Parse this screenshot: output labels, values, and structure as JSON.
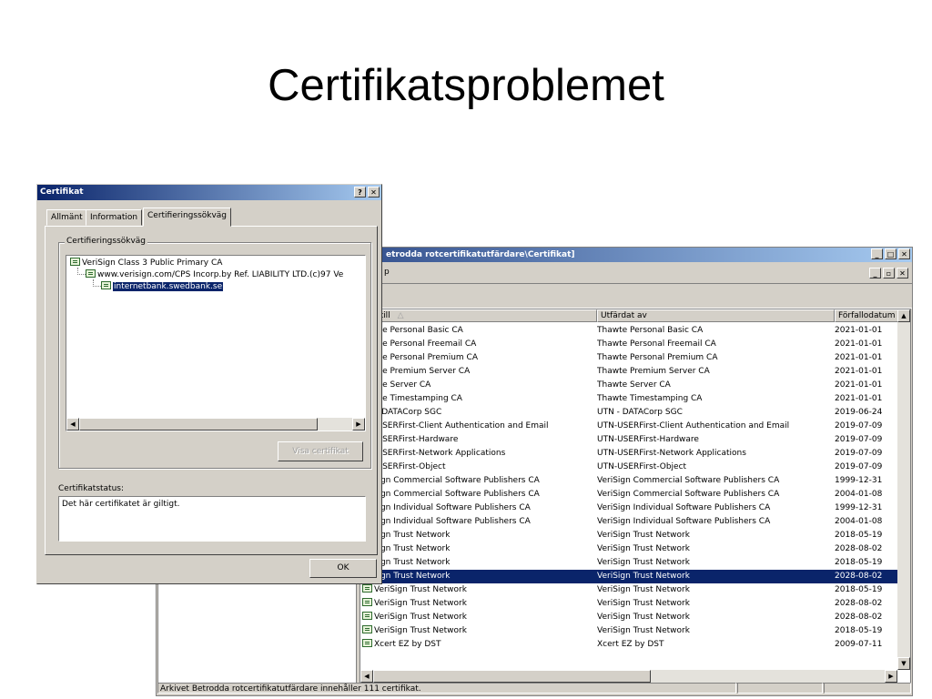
{
  "slide": {
    "title": "Certifikatsproblemet"
  },
  "store_window": {
    "title": "etrodda rotcertifikatutfärdare\\Certifikat]",
    "menu_fragment": "p",
    "columns": {
      "issued_to": "dat till",
      "issued_by": "Utfärdat av",
      "expires": "Förfallodatum"
    },
    "rows": [
      {
        "to": "hawte Personal Basic CA",
        "by": "Thawte Personal Basic CA",
        "exp": "2021-01-01"
      },
      {
        "to": "hawte Personal Freemail CA",
        "by": "Thawte Personal Freemail CA",
        "exp": "2021-01-01"
      },
      {
        "to": "hawte Personal Premium CA",
        "by": "Thawte Personal Premium CA",
        "exp": "2021-01-01"
      },
      {
        "to": "hawte Premium Server CA",
        "by": "Thawte Premium Server CA",
        "exp": "2021-01-01"
      },
      {
        "to": "hawte Server CA",
        "by": "Thawte Server CA",
        "exp": "2021-01-01"
      },
      {
        "to": "hawte Timestamping CA",
        "by": "Thawte Timestamping CA",
        "exp": "2021-01-01"
      },
      {
        "to": "TN - DATACorp SGC",
        "by": "UTN - DATACorp SGC",
        "exp": "2019-06-24"
      },
      {
        "to": "TN-USERFirst-Client Authentication and Email",
        "by": "UTN-USERFirst-Client Authentication and Email",
        "exp": "2019-07-09"
      },
      {
        "to": "TN-USERFirst-Hardware",
        "by": "UTN-USERFirst-Hardware",
        "exp": "2019-07-09"
      },
      {
        "to": "TN-USERFirst-Network Applications",
        "by": "UTN-USERFirst-Network Applications",
        "exp": "2019-07-09"
      },
      {
        "to": "TN-USERFirst-Object",
        "by": "UTN-USERFirst-Object",
        "exp": "2019-07-09"
      },
      {
        "to": "eriSign Commercial Software Publishers CA",
        "by": "VeriSign Commercial Software Publishers CA",
        "exp": "1999-12-31"
      },
      {
        "to": "eriSign Commercial Software Publishers CA",
        "by": "VeriSign Commercial Software Publishers CA",
        "exp": "2004-01-08"
      },
      {
        "to": "eriSign Individual Software Publishers CA",
        "by": "VeriSign Individual Software Publishers CA",
        "exp": "1999-12-31"
      },
      {
        "to": "eriSign Individual Software Publishers CA",
        "by": "VeriSign Individual Software Publishers CA",
        "exp": "2004-01-08"
      },
      {
        "to": "eriSign Trust Network",
        "by": "VeriSign Trust Network",
        "exp": "2018-05-19"
      },
      {
        "to": "eriSign Trust Network",
        "by": "VeriSign Trust Network",
        "exp": "2028-08-02"
      },
      {
        "to": "eriSign Trust Network",
        "by": "VeriSign Trust Network",
        "exp": "2018-05-19"
      },
      {
        "to": "eriSign Trust Network",
        "by": "VeriSign Trust Network",
        "exp": "2028-08-02",
        "selected": true
      },
      {
        "to": "VeriSign Trust Network",
        "by": "VeriSign Trust Network",
        "exp": "2018-05-19",
        "icon": true
      },
      {
        "to": "VeriSign Trust Network",
        "by": "VeriSign Trust Network",
        "exp": "2028-08-02",
        "icon": true
      },
      {
        "to": "VeriSign Trust Network",
        "by": "VeriSign Trust Network",
        "exp": "2028-08-02",
        "icon": true
      },
      {
        "to": "VeriSign Trust Network",
        "by": "VeriSign Trust Network",
        "exp": "2018-05-19",
        "icon": true
      },
      {
        "to": "Xcert EZ by DST",
        "by": "Xcert EZ by DST",
        "exp": "2009-07-11",
        "icon": true
      }
    ],
    "status": "Arkivet Betrodda rotcertifikatutfärdare innehåller 111 certifikat."
  },
  "dialog": {
    "title": "Certifikat",
    "help_btn": "?",
    "close_btn": "✕",
    "tabs": [
      "Allmänt",
      "Information",
      "Certifieringssökväg"
    ],
    "active_tab": 2,
    "group_label": "Certifieringssökväg",
    "path": [
      "VeriSign Class 3 Public Primary CA",
      "www.verisign.com/CPS Incorp.by Ref. LIABILITY LTD.(c)97 Ve",
      "internetbank.swedbank.se"
    ],
    "view_cert_button": "Visa certifikat",
    "status_label": "Certifikatstatus:",
    "status_text": "Det här certifikatet är giltigt.",
    "ok_button": "OK"
  }
}
